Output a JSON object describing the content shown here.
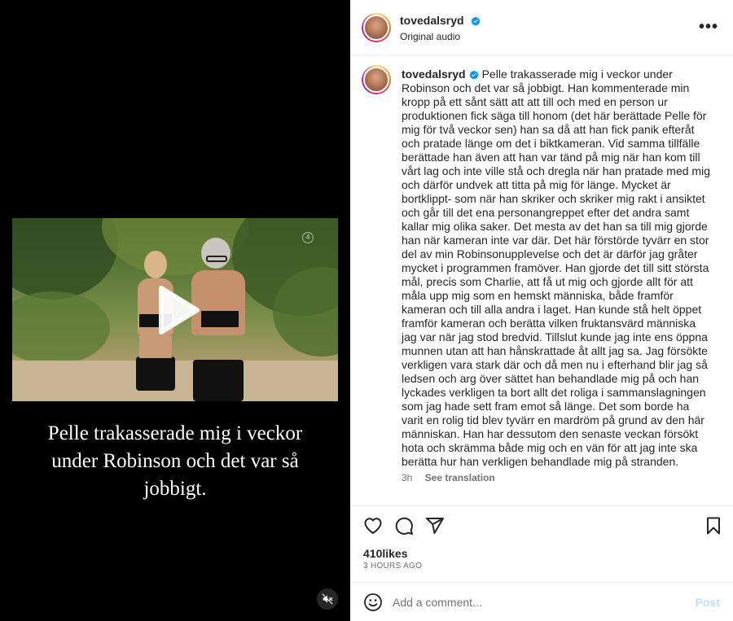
{
  "post": {
    "username": "tovedalsryd",
    "audio": "Original audio"
  },
  "media": {
    "overlay_caption": "Pelle trakasserade mig i veckor under Robinson och det var så jobbigt.",
    "corner_badge": "4"
  },
  "caption": {
    "username": "tovedalsryd",
    "text": "Pelle trakasserade mig i veckor under Robinson och det var så jobbigt. Han kommenterade min kropp på ett sånt sätt att att till och med en person ur produktionen fick säga till honom (det här berättade Pelle för mig för två veckor sen) han sa då att han fick panik efteråt och pratade länge om det i biktkameran. Vid samma tillfälle berättade han även att han var tänd på mig när han kom till vårt lag och inte ville stå och dregla när han pratade med mig och därför undvek att titta på mig för länge. Mycket är bortklippt- som när han skriker och skriker mig rakt i ansiktet och går till det ena personangreppet efter det andra samt kallar mig olika saker. Det mesta av det han sa till mig gjorde han när kameran inte var där. Det här förstörde tyvärr en stor del av min Robinsonupplevelse och det är därför jag gråter mycket i programmen framöver. Han gjorde det till sitt största mål, precis som Charlie, att få ut mig och gjorde allt för att måla upp mig som en hemskt människa, både framför kameran och till alla andra i laget. Han kunde stå helt öppet framför kameran och berätta vilken fruktansvärd människa jag var när jag stod bredvid. Tillslut kunde jag inte ens öppna munnen utan att han hånskrattade åt allt jag sa. Jag försökte verkligen vara stark där och då men nu i efterhand blir jag så ledsen och arg över sättet han behandlade mig på och han lyckades verkligen ta bort allt det roliga i sammanslagningen som jag hade sett fram emot så länge. Det som borde ha varit en rolig tid blev tyvärr en mardröm på grund av den här människan. Han har dessutom den senaste veckan försökt hota och skrämma både mig och en vän för att jag inte ska berätta hur han verkligen behandlade mig på stranden.",
    "age": "3h",
    "see_translation": "See translation"
  },
  "engagement": {
    "likes": "410likes",
    "time_ago": "3 HOURS AGO"
  },
  "comment": {
    "placeholder": "Add a comment...",
    "post_label": "Post"
  },
  "colors": {
    "verified": "#0095f6",
    "post_disabled": "#c0dffd",
    "secondary_text": "#737373"
  },
  "icons": [
    "more-options-icon",
    "verified-icon",
    "play-icon",
    "mute-icon",
    "heart-icon",
    "comment-icon",
    "share-icon",
    "bookmark-icon",
    "emoji-icon"
  ]
}
